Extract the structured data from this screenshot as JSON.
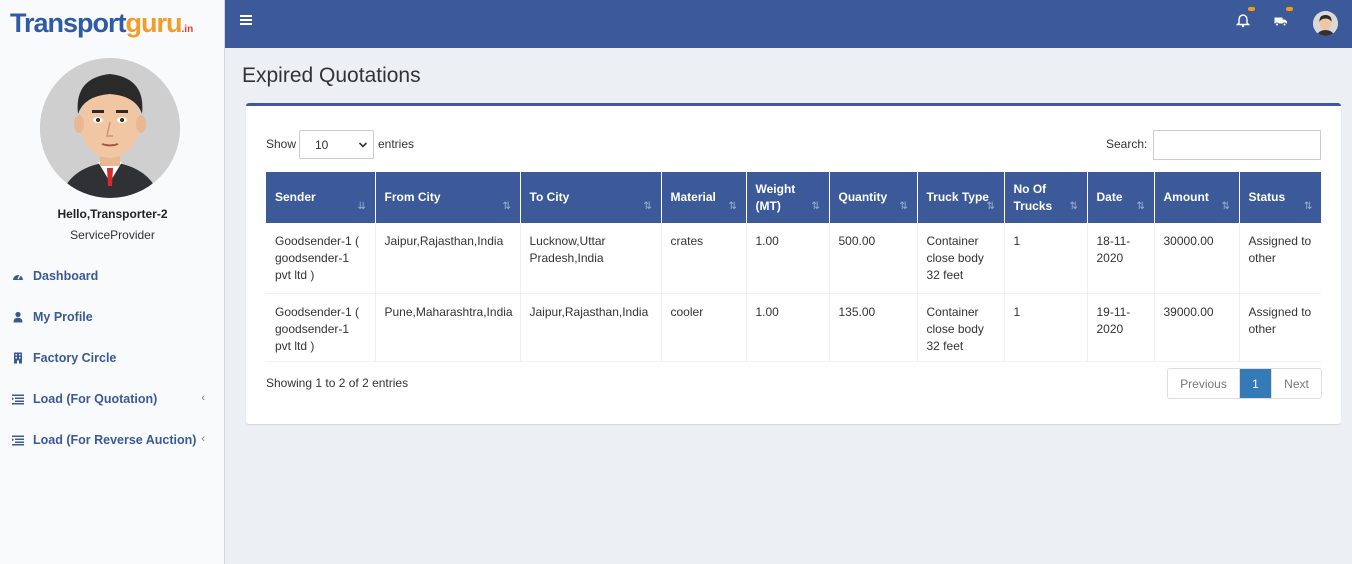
{
  "brand": {
    "part1": "Transport",
    "part2": "guru",
    "suffix": ".in"
  },
  "user": {
    "greeting": "Hello,Transporter-2",
    "role": "ServiceProvider"
  },
  "sidebar": {
    "items": [
      {
        "label": "Dashboard",
        "icon": "dashboard-icon"
      },
      {
        "label": "My Profile",
        "icon": "user-icon"
      },
      {
        "label": "Factory Circle",
        "icon": "building-icon"
      },
      {
        "label": "Load (For Quotation)",
        "icon": "list-icon",
        "chevron": "‹"
      },
      {
        "label": "Load (For Reverse Auction)",
        "icon": "list-icon",
        "chevron": "‹"
      }
    ]
  },
  "header": {
    "icons": [
      "bell-icon",
      "truck-icon",
      "user-avatar"
    ],
    "accent": "#3c5a99"
  },
  "page": {
    "title": "Expired Quotations"
  },
  "table_controls": {
    "show_label": "Show",
    "entries_value": "10",
    "entries_label": "entries",
    "search_label": "Search:",
    "search_value": ""
  },
  "table": {
    "headers": [
      "Sender",
      "From City",
      "To City",
      "Material",
      "Weight (MT)",
      "Quantity",
      "Truck Type",
      "No Of Trucks",
      "Date",
      "Amount",
      "Status"
    ],
    "rows": [
      [
        "Goodsender-1 ( goodsender-1 pvt ltd )",
        "Jaipur,Rajasthan,India",
        "Lucknow,Uttar Pradesh,India",
        "crates",
        "1.00",
        "500.00",
        "Container close body 32 feet",
        "1",
        "18-11-2020",
        "30000.00",
        "Assigned to other"
      ],
      [
        "Goodsender-1 ( goodsender-1 pvt ltd )",
        "Pune,Maharashtra,India",
        "Jaipur,Rajasthan,India",
        "cooler",
        "1.00",
        "135.00",
        "Container close body 32 feet",
        "1",
        "19-11-2020",
        "39000.00",
        "Assigned to other"
      ]
    ]
  },
  "footer": {
    "info": "Showing 1 to 2 of 2 entries",
    "prev": "Previous",
    "page": "1",
    "next": "Next"
  }
}
